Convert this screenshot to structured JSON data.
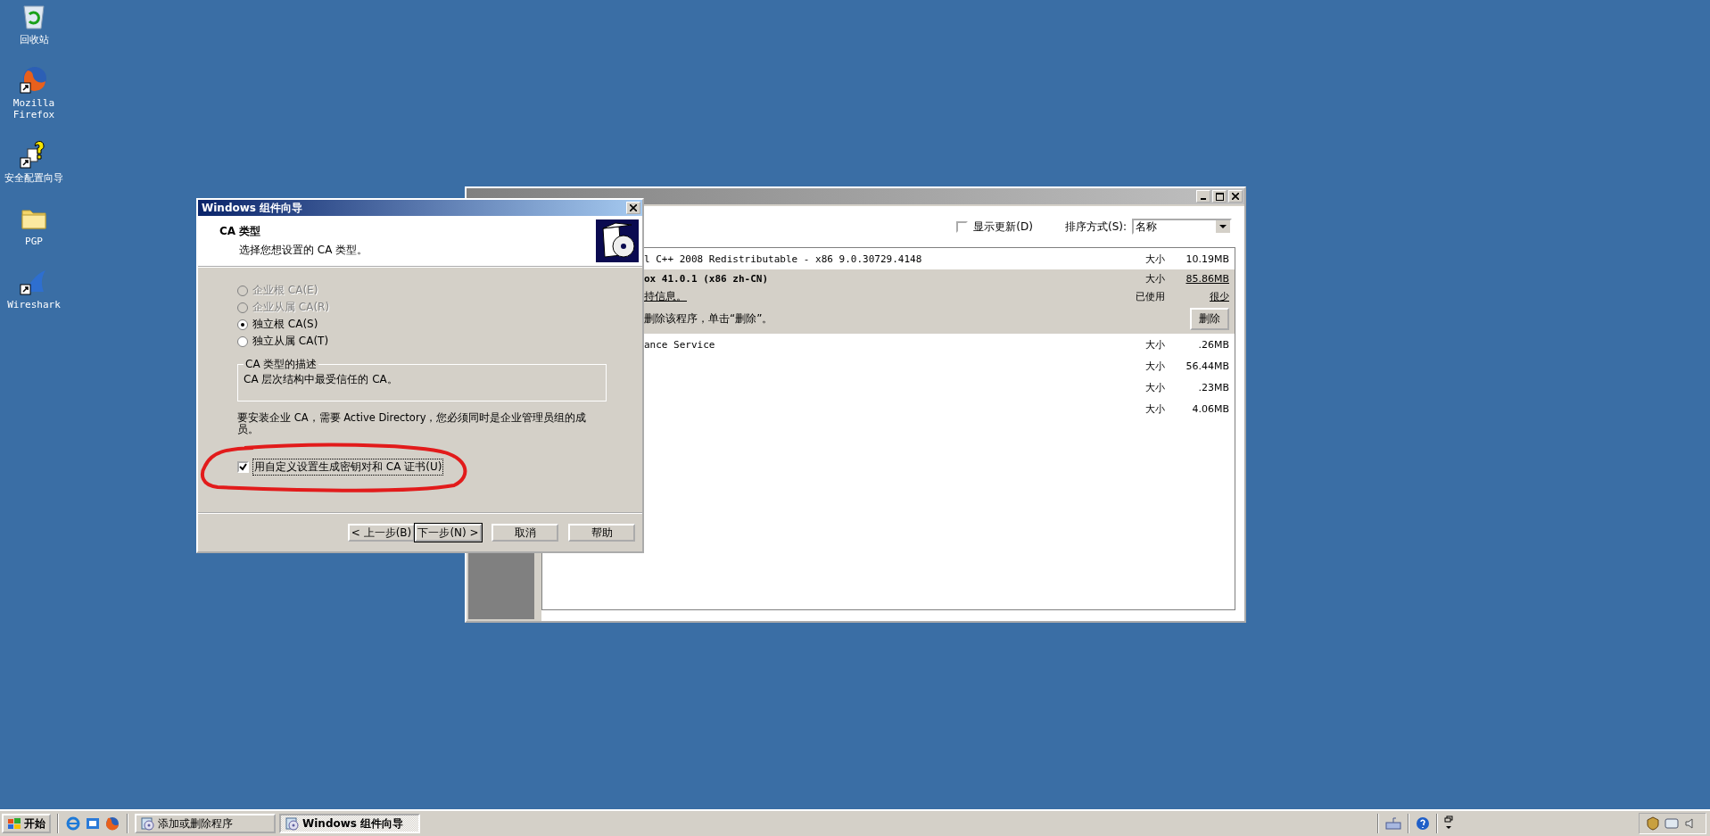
{
  "desktop_icons": [
    {
      "label": "回收站",
      "kind": "trash"
    },
    {
      "label": "Mozilla Firefox",
      "kind": "browser"
    },
    {
      "label": "安全配置向导",
      "kind": "wizard"
    },
    {
      "label": "PGP",
      "kind": "folder"
    },
    {
      "label": "Wireshark",
      "kind": "fin"
    }
  ],
  "programs_window": {
    "show_updates": {
      "label": "显示更新(D)",
      "checked": false
    },
    "sort_label": "排序方式(S):",
    "sort_value": "名称",
    "rows": [
      {
        "name": "l C++ 2008 Redistributable - x86 9.0.30729.4148",
        "size_label": "大小",
        "size": "10.19MB",
        "selected": false
      },
      {
        "name": "ox 41.0.1 (x86 zh-CN)",
        "size_label": "大小",
        "size": "85.86MB",
        "selected": true,
        "support_link": "持信息。",
        "used_label": "已使用",
        "used": "很少",
        "remove_text": "删除该程序，单击“删除”。",
        "remove_button": "删除"
      },
      {
        "name": "ance Service",
        "size_label": "大小",
        "size": ".26MB",
        "selected": false
      },
      {
        "size_label": "大小",
        "size": "56.44MB",
        "selected": false
      },
      {
        "size_label": "大小",
        "size": ".23MB",
        "selected": false
      },
      {
        "size_label": "大小",
        "size": "4.06MB",
        "selected": false
      }
    ]
  },
  "wizard": {
    "title": "Windows 组件向导",
    "heading": "CA 类型",
    "subtitle": "选择您想设置的 CA 类型。",
    "options": [
      {
        "label": "企业根 CA(E)",
        "selected": false,
        "disabled": true
      },
      {
        "label": "企业从属 CA(R)",
        "selected": false,
        "disabled": true
      },
      {
        "label": "独立根 CA(S)",
        "selected": true,
        "disabled": false
      },
      {
        "label": "独立从属 CA(T)",
        "selected": false,
        "disabled": false
      }
    ],
    "description_title": "CA 类型的描述",
    "description": "CA 层次结构中最受信任的 CA。",
    "note": "要安装企业 CA，需要 Active Directory，您必须同时是企业管理员组的成员。",
    "custom_keys": {
      "label": "用自定义设置生成密钥对和 CA 证书(U)",
      "checked": true
    },
    "buttons": [
      {
        "label": "< 上一步(B)",
        "default": false
      },
      {
        "label": "下一步(N) >",
        "default": true
      },
      {
        "label": "取消",
        "default": false
      },
      {
        "label": "帮助",
        "default": false
      }
    ]
  },
  "taskbar": {
    "start": "开始",
    "tasks": [
      {
        "label": "添加或删除程序",
        "selected": false
      },
      {
        "label": "Windows 组件向导",
        "selected": true
      }
    ]
  }
}
